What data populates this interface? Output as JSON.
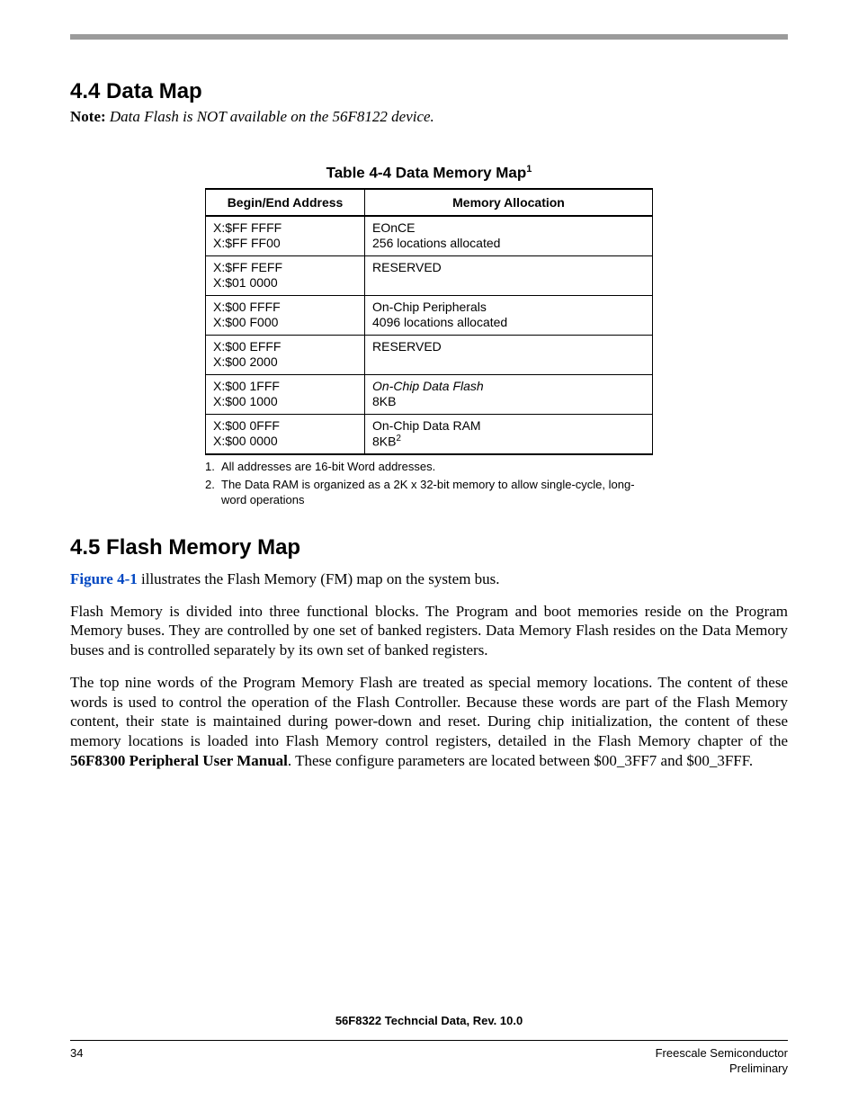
{
  "section44": {
    "heading": "4.4   Data Map",
    "note_label": "Note:",
    "note_body": " Data Flash is NOT available on the 56F8122 device."
  },
  "table": {
    "caption_prefix": "Table 4-4 Data Memory Map",
    "caption_sup": "1",
    "headers": {
      "col1": "Begin/End Address",
      "col2": "Memory Allocation"
    },
    "rows": [
      {
        "addr1": "X:$FF FFFF",
        "addr2": "X:$FF FF00",
        "alloc1": "EOnCE",
        "alloc2": "256 locations allocated",
        "ital": false
      },
      {
        "addr1": "X:$FF FEFF",
        "addr2": "X:$01 0000",
        "alloc1": "RESERVED",
        "alloc2": "",
        "ital": false
      },
      {
        "addr1": "X:$00 FFFF",
        "addr2": "X:$00 F000",
        "alloc1": "On-Chip Peripherals",
        "alloc2": "4096 locations allocated",
        "ital": false
      },
      {
        "addr1": "X:$00 EFFF",
        "addr2": "X:$00 2000",
        "alloc1": "RESERVED",
        "alloc2": "",
        "ital": false
      },
      {
        "addr1": "X:$00 1FFF",
        "addr2": "X:$00 1000",
        "alloc1": "On-Chip Data Flash",
        "alloc2": "8KB",
        "ital": true
      },
      {
        "addr1": "X:$00 0FFF",
        "addr2": "X:$00 0000",
        "alloc1": "On-Chip Data RAM",
        "alloc2_html": "8KB<sup>2</sup>",
        "ital": false
      }
    ],
    "footnotes": [
      {
        "num": "1.",
        "text": "All addresses are 16-bit Word addresses."
      },
      {
        "num": "2.",
        "text": "The Data RAM is organized as a 2K x 32-bit memory to allow single-cycle, long-word operations"
      }
    ]
  },
  "section45": {
    "heading": "4.5   Flash Memory Map",
    "p1_link": "Figure 4-1",
    "p1_rest": " illustrates the Flash Memory (FM) map on the system bus.",
    "p2": "Flash Memory is divided into three functional blocks. The Program and boot memories reside on the Program Memory buses. They are controlled by one set of banked registers. Data Memory Flash resides on the Data Memory buses and is controlled separately by its own set of banked registers.",
    "p3_a": "The top nine words of the Program Memory Flash are treated as special memory locations. The content of these words is used to control the operation of the Flash Controller. Because these words are part of the Flash Memory content, their state is maintained during power-down and reset. During chip initialization, the content of these memory locations is loaded into Flash Memory control registers, detailed in the Flash Memory chapter of the ",
    "p3_bold": "56F8300 Peripheral User Manual",
    "p3_b": ". These configure parameters are located between $00_3FF7 and $00_3FFF."
  },
  "footer": {
    "title": "56F8322 Techncial Data, Rev. 10.0",
    "page": "34",
    "right1": "Freescale Semiconductor",
    "right2": "Preliminary"
  }
}
